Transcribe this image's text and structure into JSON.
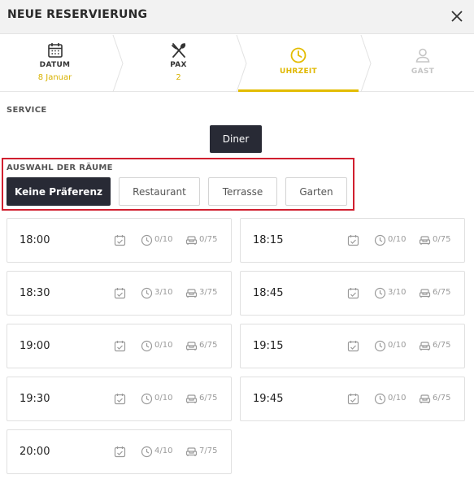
{
  "header": {
    "title": "NEUE RESERVIERUNG"
  },
  "steps": [
    {
      "label": "DATUM",
      "value": "8 Januar"
    },
    {
      "label": "PAX",
      "value": "2"
    },
    {
      "label": "UHRZEIT",
      "value": ""
    },
    {
      "label": "GAST",
      "value": ""
    }
  ],
  "service": {
    "label": "SERVICE",
    "selected": "Diner"
  },
  "rooms": {
    "label": "AUSWAHL DER RÄUME",
    "options": [
      "Keine Präferenz",
      "Restaurant",
      "Terrasse",
      "Garten"
    ],
    "selected": "Keine Präferenz"
  },
  "slots": [
    {
      "time": "18:00",
      "reservations": "0/10",
      "capacity": "0/75"
    },
    {
      "time": "18:15",
      "reservations": "0/10",
      "capacity": "0/75"
    },
    {
      "time": "18:30",
      "reservations": "3/10",
      "capacity": "3/75"
    },
    {
      "time": "18:45",
      "reservations": "3/10",
      "capacity": "6/75"
    },
    {
      "time": "19:00",
      "reservations": "0/10",
      "capacity": "6/75"
    },
    {
      "time": "19:15",
      "reservations": "0/10",
      "capacity": "6/75"
    },
    {
      "time": "19:30",
      "reservations": "0/10",
      "capacity": "6/75"
    },
    {
      "time": "19:45",
      "reservations": "0/10",
      "capacity": "6/75"
    },
    {
      "time": "20:00",
      "reservations": "4/10",
      "capacity": "7/75"
    }
  ],
  "colors": {
    "accent": "#e3bc00",
    "dark": "#282a35",
    "highlight_border": "#d11f2f"
  }
}
